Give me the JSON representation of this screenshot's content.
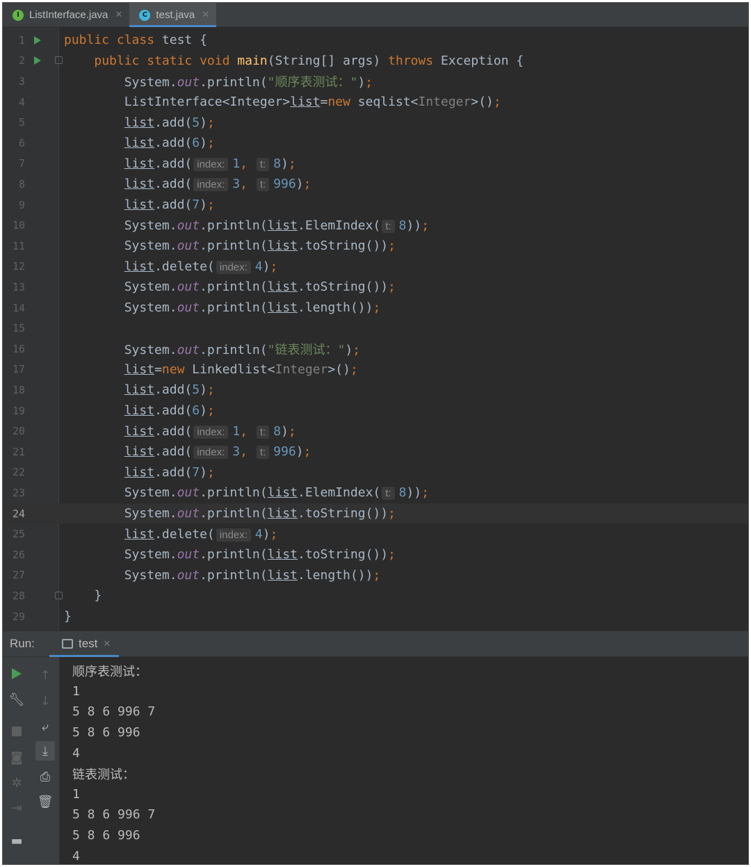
{
  "tabs": [
    {
      "label": "ListInterface.java",
      "icon": "interface-icon",
      "icon_letter": "I",
      "active": false
    },
    {
      "label": "test.java",
      "icon": "class-icon",
      "icon_letter": "C",
      "active": true
    }
  ],
  "editor": {
    "current_line": 24,
    "lines": [
      {
        "n": "1",
        "run": true,
        "fold": false,
        "tokens": [
          [
            "kw",
            "public class "
          ],
          [
            "t",
            "test {"
          ]
        ]
      },
      {
        "n": "2",
        "run": true,
        "fold": true,
        "tokens": [
          [
            "t",
            "    "
          ],
          [
            "kw",
            "public static void "
          ],
          [
            "fn",
            "main"
          ],
          [
            "t",
            "(String[] args) "
          ],
          [
            "kw",
            "throws "
          ],
          [
            "t",
            "Exception {"
          ]
        ]
      },
      {
        "n": "3",
        "tokens": [
          [
            "t",
            "        System."
          ],
          [
            "it",
            "out"
          ],
          [
            "t",
            ".println("
          ],
          [
            "str",
            "\"顺序表测试：\""
          ],
          [
            "t",
            ")"
          ],
          [
            "kw",
            ";"
          ]
        ]
      },
      {
        "n": "4",
        "tokens": [
          [
            "t",
            "        ListInterface<Integer>"
          ],
          [
            "ul",
            "list"
          ],
          [
            "t",
            "="
          ],
          [
            "kw",
            "new "
          ],
          [
            "t",
            "seqlist<"
          ],
          [
            "gen",
            "Integer"
          ],
          [
            "t",
            ">()"
          ],
          [
            "kw",
            ";"
          ]
        ]
      },
      {
        "n": "5",
        "tokens": [
          [
            "t",
            "        "
          ],
          [
            "ul",
            "list"
          ],
          [
            "t",
            ".add("
          ],
          [
            "num",
            "5"
          ],
          [
            "t",
            ")"
          ],
          [
            "kw",
            ";"
          ]
        ]
      },
      {
        "n": "6",
        "tokens": [
          [
            "t",
            "        "
          ],
          [
            "ul",
            "list"
          ],
          [
            "t",
            ".add("
          ],
          [
            "num",
            "6"
          ],
          [
            "t",
            ")"
          ],
          [
            "kw",
            ";"
          ]
        ]
      },
      {
        "n": "7",
        "tokens": [
          [
            "t",
            "        "
          ],
          [
            "ul",
            "list"
          ],
          [
            "t",
            ".add("
          ],
          [
            "hint",
            "index:"
          ],
          [
            "num",
            "1"
          ],
          [
            "kw",
            ", "
          ],
          [
            "hint",
            "t:"
          ],
          [
            "num",
            "8"
          ],
          [
            "t",
            ")"
          ],
          [
            "kw",
            ";"
          ]
        ]
      },
      {
        "n": "8",
        "tokens": [
          [
            "t",
            "        "
          ],
          [
            "ul",
            "list"
          ],
          [
            "t",
            ".add("
          ],
          [
            "hint",
            "index:"
          ],
          [
            "num",
            "3"
          ],
          [
            "kw",
            ", "
          ],
          [
            "hint",
            "t:"
          ],
          [
            "num",
            "996"
          ],
          [
            "t",
            ")"
          ],
          [
            "kw",
            ";"
          ]
        ]
      },
      {
        "n": "9",
        "tokens": [
          [
            "t",
            "        "
          ],
          [
            "ul",
            "list"
          ],
          [
            "t",
            ".add("
          ],
          [
            "num",
            "7"
          ],
          [
            "t",
            ")"
          ],
          [
            "kw",
            ";"
          ]
        ]
      },
      {
        "n": "10",
        "tokens": [
          [
            "t",
            "        System."
          ],
          [
            "it",
            "out"
          ],
          [
            "t",
            ".println("
          ],
          [
            "ul",
            "list"
          ],
          [
            "t",
            ".ElemIndex("
          ],
          [
            "hint",
            "t:"
          ],
          [
            "num",
            "8"
          ],
          [
            "t",
            "))"
          ],
          [
            "kw",
            ";"
          ]
        ]
      },
      {
        "n": "11",
        "tokens": [
          [
            "t",
            "        System."
          ],
          [
            "it",
            "out"
          ],
          [
            "t",
            ".println("
          ],
          [
            "ul",
            "list"
          ],
          [
            "t",
            ".toString())"
          ],
          [
            "kw",
            ";"
          ]
        ]
      },
      {
        "n": "12",
        "tokens": [
          [
            "t",
            "        "
          ],
          [
            "ul",
            "list"
          ],
          [
            "t",
            ".delete("
          ],
          [
            "hint",
            "index:"
          ],
          [
            "num",
            "4"
          ],
          [
            "t",
            ")"
          ],
          [
            "kw",
            ";"
          ]
        ]
      },
      {
        "n": "13",
        "tokens": [
          [
            "t",
            "        System."
          ],
          [
            "it",
            "out"
          ],
          [
            "t",
            ".println("
          ],
          [
            "ul",
            "list"
          ],
          [
            "t",
            ".toString())"
          ],
          [
            "kw",
            ";"
          ]
        ]
      },
      {
        "n": "14",
        "tokens": [
          [
            "t",
            "        System."
          ],
          [
            "it",
            "out"
          ],
          [
            "t",
            ".println("
          ],
          [
            "ul",
            "list"
          ],
          [
            "t",
            ".length())"
          ],
          [
            "kw",
            ";"
          ]
        ]
      },
      {
        "n": "15",
        "tokens": []
      },
      {
        "n": "16",
        "tokens": [
          [
            "t",
            "        System."
          ],
          [
            "it",
            "out"
          ],
          [
            "t",
            ".println("
          ],
          [
            "str",
            "\"链表测试：\""
          ],
          [
            "t",
            ")"
          ],
          [
            "kw",
            ";"
          ]
        ]
      },
      {
        "n": "17",
        "tokens": [
          [
            "t",
            "        "
          ],
          [
            "ul",
            "list"
          ],
          [
            "t",
            "="
          ],
          [
            "kw",
            "new "
          ],
          [
            "t",
            "Linkedlist<"
          ],
          [
            "gen",
            "Integer"
          ],
          [
            "t",
            ">()"
          ],
          [
            "kw",
            ";"
          ]
        ]
      },
      {
        "n": "18",
        "tokens": [
          [
            "t",
            "        "
          ],
          [
            "ul",
            "list"
          ],
          [
            "t",
            ".add("
          ],
          [
            "num",
            "5"
          ],
          [
            "t",
            ")"
          ],
          [
            "kw",
            ";"
          ]
        ]
      },
      {
        "n": "19",
        "tokens": [
          [
            "t",
            "        "
          ],
          [
            "ul",
            "list"
          ],
          [
            "t",
            ".add("
          ],
          [
            "num",
            "6"
          ],
          [
            "t",
            ")"
          ],
          [
            "kw",
            ";"
          ]
        ]
      },
      {
        "n": "20",
        "tokens": [
          [
            "t",
            "        "
          ],
          [
            "ul",
            "list"
          ],
          [
            "t",
            ".add("
          ],
          [
            "hint",
            "index:"
          ],
          [
            "num",
            "1"
          ],
          [
            "kw",
            ", "
          ],
          [
            "hint",
            "t:"
          ],
          [
            "num",
            "8"
          ],
          [
            "t",
            ")"
          ],
          [
            "kw",
            ";"
          ]
        ]
      },
      {
        "n": "21",
        "tokens": [
          [
            "t",
            "        "
          ],
          [
            "ul",
            "list"
          ],
          [
            "t",
            ".add("
          ],
          [
            "hint",
            "index:"
          ],
          [
            "num",
            "3"
          ],
          [
            "kw",
            ", "
          ],
          [
            "hint",
            "t:"
          ],
          [
            "num",
            "996"
          ],
          [
            "t",
            ")"
          ],
          [
            "kw",
            ";"
          ]
        ]
      },
      {
        "n": "22",
        "tokens": [
          [
            "t",
            "        "
          ],
          [
            "ul",
            "list"
          ],
          [
            "t",
            ".add("
          ],
          [
            "num",
            "7"
          ],
          [
            "t",
            ")"
          ],
          [
            "kw",
            ";"
          ]
        ]
      },
      {
        "n": "23",
        "tokens": [
          [
            "t",
            "        System."
          ],
          [
            "it",
            "out"
          ],
          [
            "t",
            ".println("
          ],
          [
            "ul",
            "list"
          ],
          [
            "t",
            ".ElemIndex("
          ],
          [
            "hint",
            "t:"
          ],
          [
            "num",
            "8"
          ],
          [
            "t",
            "))"
          ],
          [
            "kw",
            ";"
          ]
        ]
      },
      {
        "n": "24",
        "tokens": [
          [
            "t",
            "        System."
          ],
          [
            "it",
            "out"
          ],
          [
            "t",
            ".println("
          ],
          [
            "ul",
            "list"
          ],
          [
            "t",
            ".toString())"
          ],
          [
            "kw",
            ";"
          ]
        ]
      },
      {
        "n": "25",
        "tokens": [
          [
            "t",
            "        "
          ],
          [
            "ul",
            "list"
          ],
          [
            "t",
            ".delete("
          ],
          [
            "hint",
            "index:"
          ],
          [
            "num",
            "4"
          ],
          [
            "t",
            ")"
          ],
          [
            "kw",
            ";"
          ]
        ]
      },
      {
        "n": "26",
        "tokens": [
          [
            "t",
            "        System."
          ],
          [
            "it",
            "out"
          ],
          [
            "t",
            ".println("
          ],
          [
            "ul",
            "list"
          ],
          [
            "t",
            ".toString())"
          ],
          [
            "kw",
            ";"
          ]
        ]
      },
      {
        "n": "27",
        "tokens": [
          [
            "t",
            "        System."
          ],
          [
            "it",
            "out"
          ],
          [
            "t",
            ".println("
          ],
          [
            "ul",
            "list"
          ],
          [
            "t",
            ".length())"
          ],
          [
            "kw",
            ";"
          ]
        ]
      },
      {
        "n": "28",
        "fold": true,
        "tokens": [
          [
            "t",
            "    }"
          ]
        ]
      },
      {
        "n": "29",
        "tokens": [
          [
            "t",
            "}"
          ]
        ]
      }
    ]
  },
  "run_panel": {
    "title": "Run:",
    "tab_label": "test",
    "left_icons": [
      "play-icon",
      "wrench-icon",
      "stop-icon",
      "camera-icon",
      "debug-icon",
      "login-icon",
      "layout-icon"
    ],
    "right_icons": [
      "arrow-up-icon",
      "arrow-down-icon",
      "soft-wrap-icon",
      "scroll-to-end-icon",
      "print-icon",
      "trash-icon"
    ],
    "output": [
      "顺序表测试：",
      "1",
      "5 8 6 996 7",
      "5 8 6 996",
      "4",
      "链表测试：",
      "1",
      "5 8 6 996 7",
      "5 8 6 996",
      "4"
    ]
  },
  "colors": {
    "keyword": "#cc7832",
    "method": "#ffc66d",
    "string": "#6a8759",
    "number": "#6897bb",
    "field": "#9876aa",
    "run_green": "#499c54",
    "accent_blue": "#4a88c7"
  }
}
